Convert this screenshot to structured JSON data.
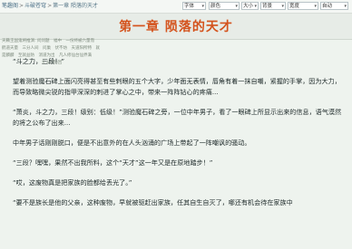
{
  "breadcrumb": {
    "home": "笔趣阁",
    "book": "斗破苍穹",
    "chapter": "第一章 陨落的天才",
    "sep": ">"
  },
  "controls": {
    "font": "字体",
    "color": "颜色",
    "size": "大小",
    "bg": "背景",
    "width": "宽度",
    "extra": "自动"
  },
  "chapter": {
    "title": "第一章 陨落的天才"
  },
  "sidebar_hint": {
    "line1": "天籁王国鬼将推演: 问问题　福中　一份终被六量而　鹤道天量　三分人间　问巢　伏不坊　天道阳所特　就是麟麟　至就益防　消道为出　凡人修仙台仙界满",
    "line2": "大火消防回"
  },
  "paragraphs": [
    "“斗之力，三段！”",
    "望着测验魔石碑上面闪亮得甚至有些刺眼的五个大字，少年面无表情，唇角有着一抹自嘲，紧握的手掌，因为大力，而导致略微尖锐的指甲深深的刺进了掌心之中，带来一阵阵钻心的疼痛...",
    "“萧炎，斗之力，三段！级别：低级！”测验魔石碑之旁，一位中年男子，看了一眼碑上所显示出来的信息，语气漠然的将之公布了出来...",
    "中年男子话刚刚脱口，便是不出意外的在人头汹涌的广场上带起了一阵嘲讽的骚动。",
    "“三段？嘿嘿，果然不出我所料，这个“天才”这一年又是在原地踏步！”",
    "“哎，这废物真是把家族的脸都给丢光了。”",
    "“要不是族长是他的父亲，这种废物，早就被驱赶出家族，任其自生自灭了，哪还有机会待在家族中"
  ]
}
